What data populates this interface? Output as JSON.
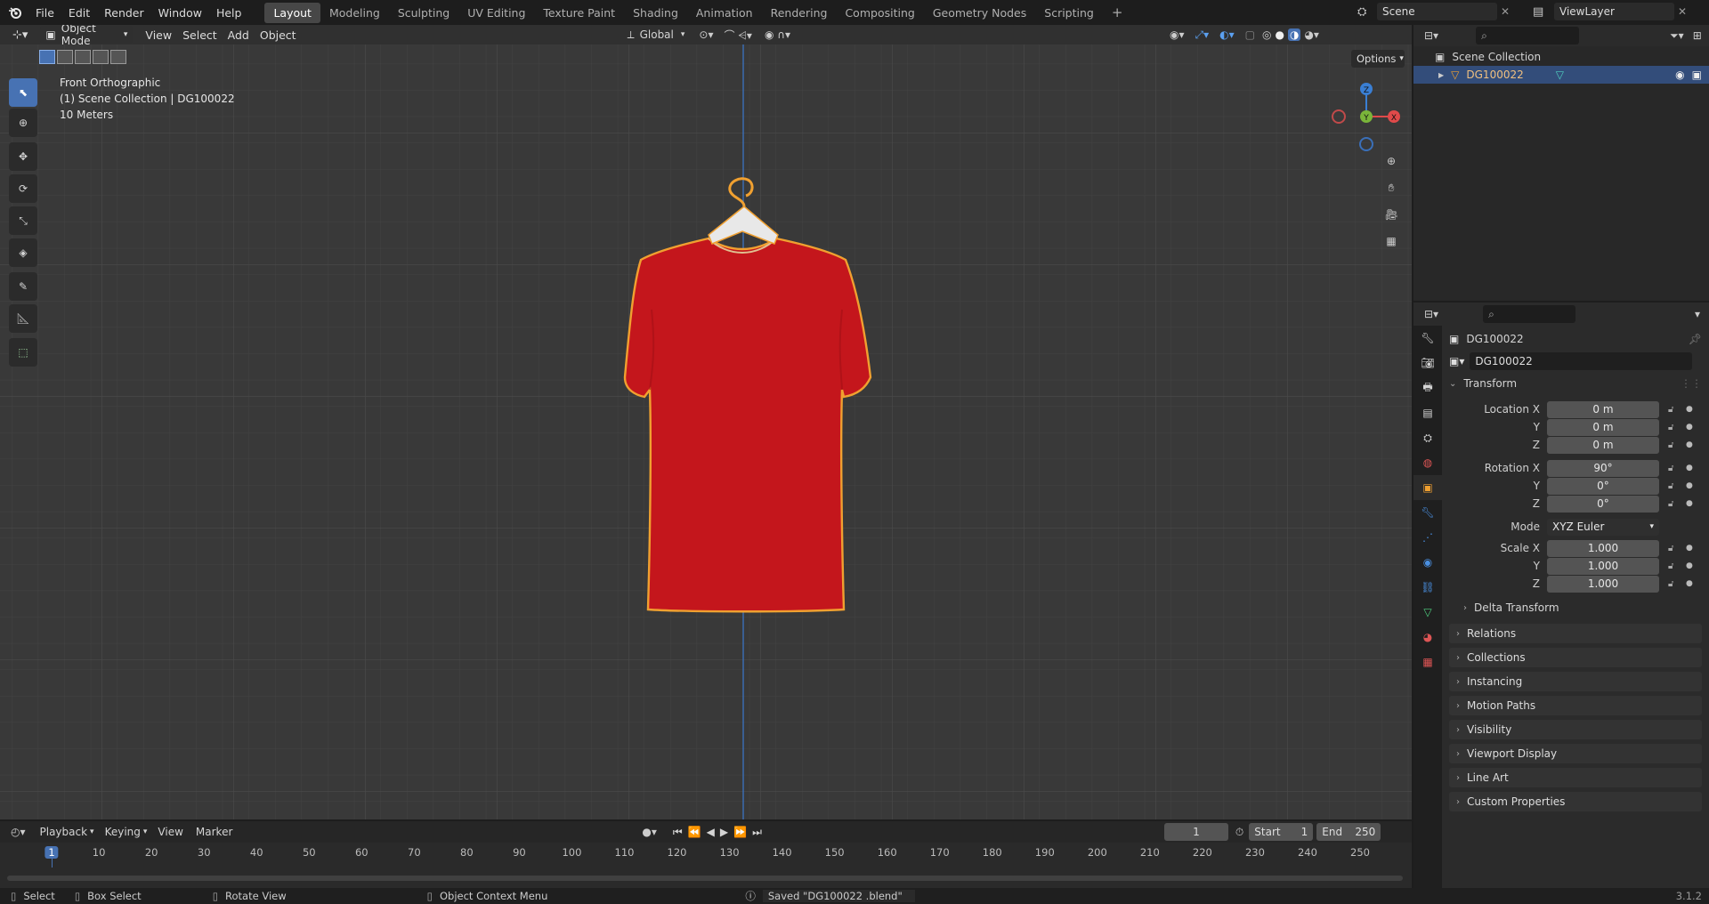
{
  "topbar": {
    "menus": [
      "File",
      "Edit",
      "Render",
      "Window",
      "Help"
    ],
    "workspaces": [
      "Layout",
      "Modeling",
      "Sculpting",
      "UV Editing",
      "Texture Paint",
      "Shading",
      "Animation",
      "Rendering",
      "Compositing",
      "Geometry Nodes",
      "Scripting"
    ],
    "active_workspace": "Layout",
    "scene": "Scene",
    "view_layer": "ViewLayer"
  },
  "viewport": {
    "mode": "Object Mode",
    "menus": [
      "View",
      "Select",
      "Add",
      "Object"
    ],
    "orientation": "Global",
    "options_label": "Options",
    "overlay_title": "Front Orthographic",
    "overlay_collection": "(1) Scene Collection | DG100022",
    "overlay_scale": "10 Meters",
    "axes": {
      "x": "X",
      "y": "Y",
      "z": "Z"
    },
    "colors": {
      "x": "#e04a4a",
      "y": "#7ab53a",
      "z": "#3a7fd4",
      "selection": "#f0a030",
      "shirt": "#c4161c"
    }
  },
  "outliner": {
    "root": "Scene Collection",
    "item": "DG100022"
  },
  "properties": {
    "object_name": "DG100022",
    "datablock": "DG100022",
    "transform_label": "Transform",
    "location": {
      "label": "Location X",
      "x": "0 m",
      "y": "0 m",
      "z": "0 m"
    },
    "rotation": {
      "label": "Rotation X",
      "x": "90°",
      "y": "0°",
      "z": "0°"
    },
    "mode_label": "Mode",
    "mode_value": "XYZ Euler",
    "scale": {
      "label": "Scale X",
      "x": "1.000",
      "y": "1.000",
      "z": "1.000"
    },
    "axis_y": "Y",
    "axis_z": "Z",
    "delta": "Delta Transform",
    "panels": [
      "Relations",
      "Collections",
      "Instancing",
      "Motion Paths",
      "Visibility",
      "Viewport Display",
      "Line Art",
      "Custom Properties"
    ]
  },
  "timeline": {
    "menus": [
      "Playback",
      "Keying",
      "View",
      "Marker"
    ],
    "current_frame": "1",
    "start_label": "Start",
    "start": "1",
    "end_label": "End",
    "end": "250",
    "ticks": [
      "1",
      "10",
      "20",
      "30",
      "40",
      "50",
      "60",
      "70",
      "80",
      "90",
      "100",
      "110",
      "120",
      "130",
      "140",
      "150",
      "160",
      "170",
      "180",
      "190",
      "200",
      "210",
      "220",
      "230",
      "240",
      "250"
    ]
  },
  "status": {
    "select": "Select",
    "box_select": "Box Select",
    "rotate": "Rotate View",
    "context": "Object Context Menu",
    "message": "Saved \"DG100022 .blend\"",
    "version": "3.1.2"
  }
}
